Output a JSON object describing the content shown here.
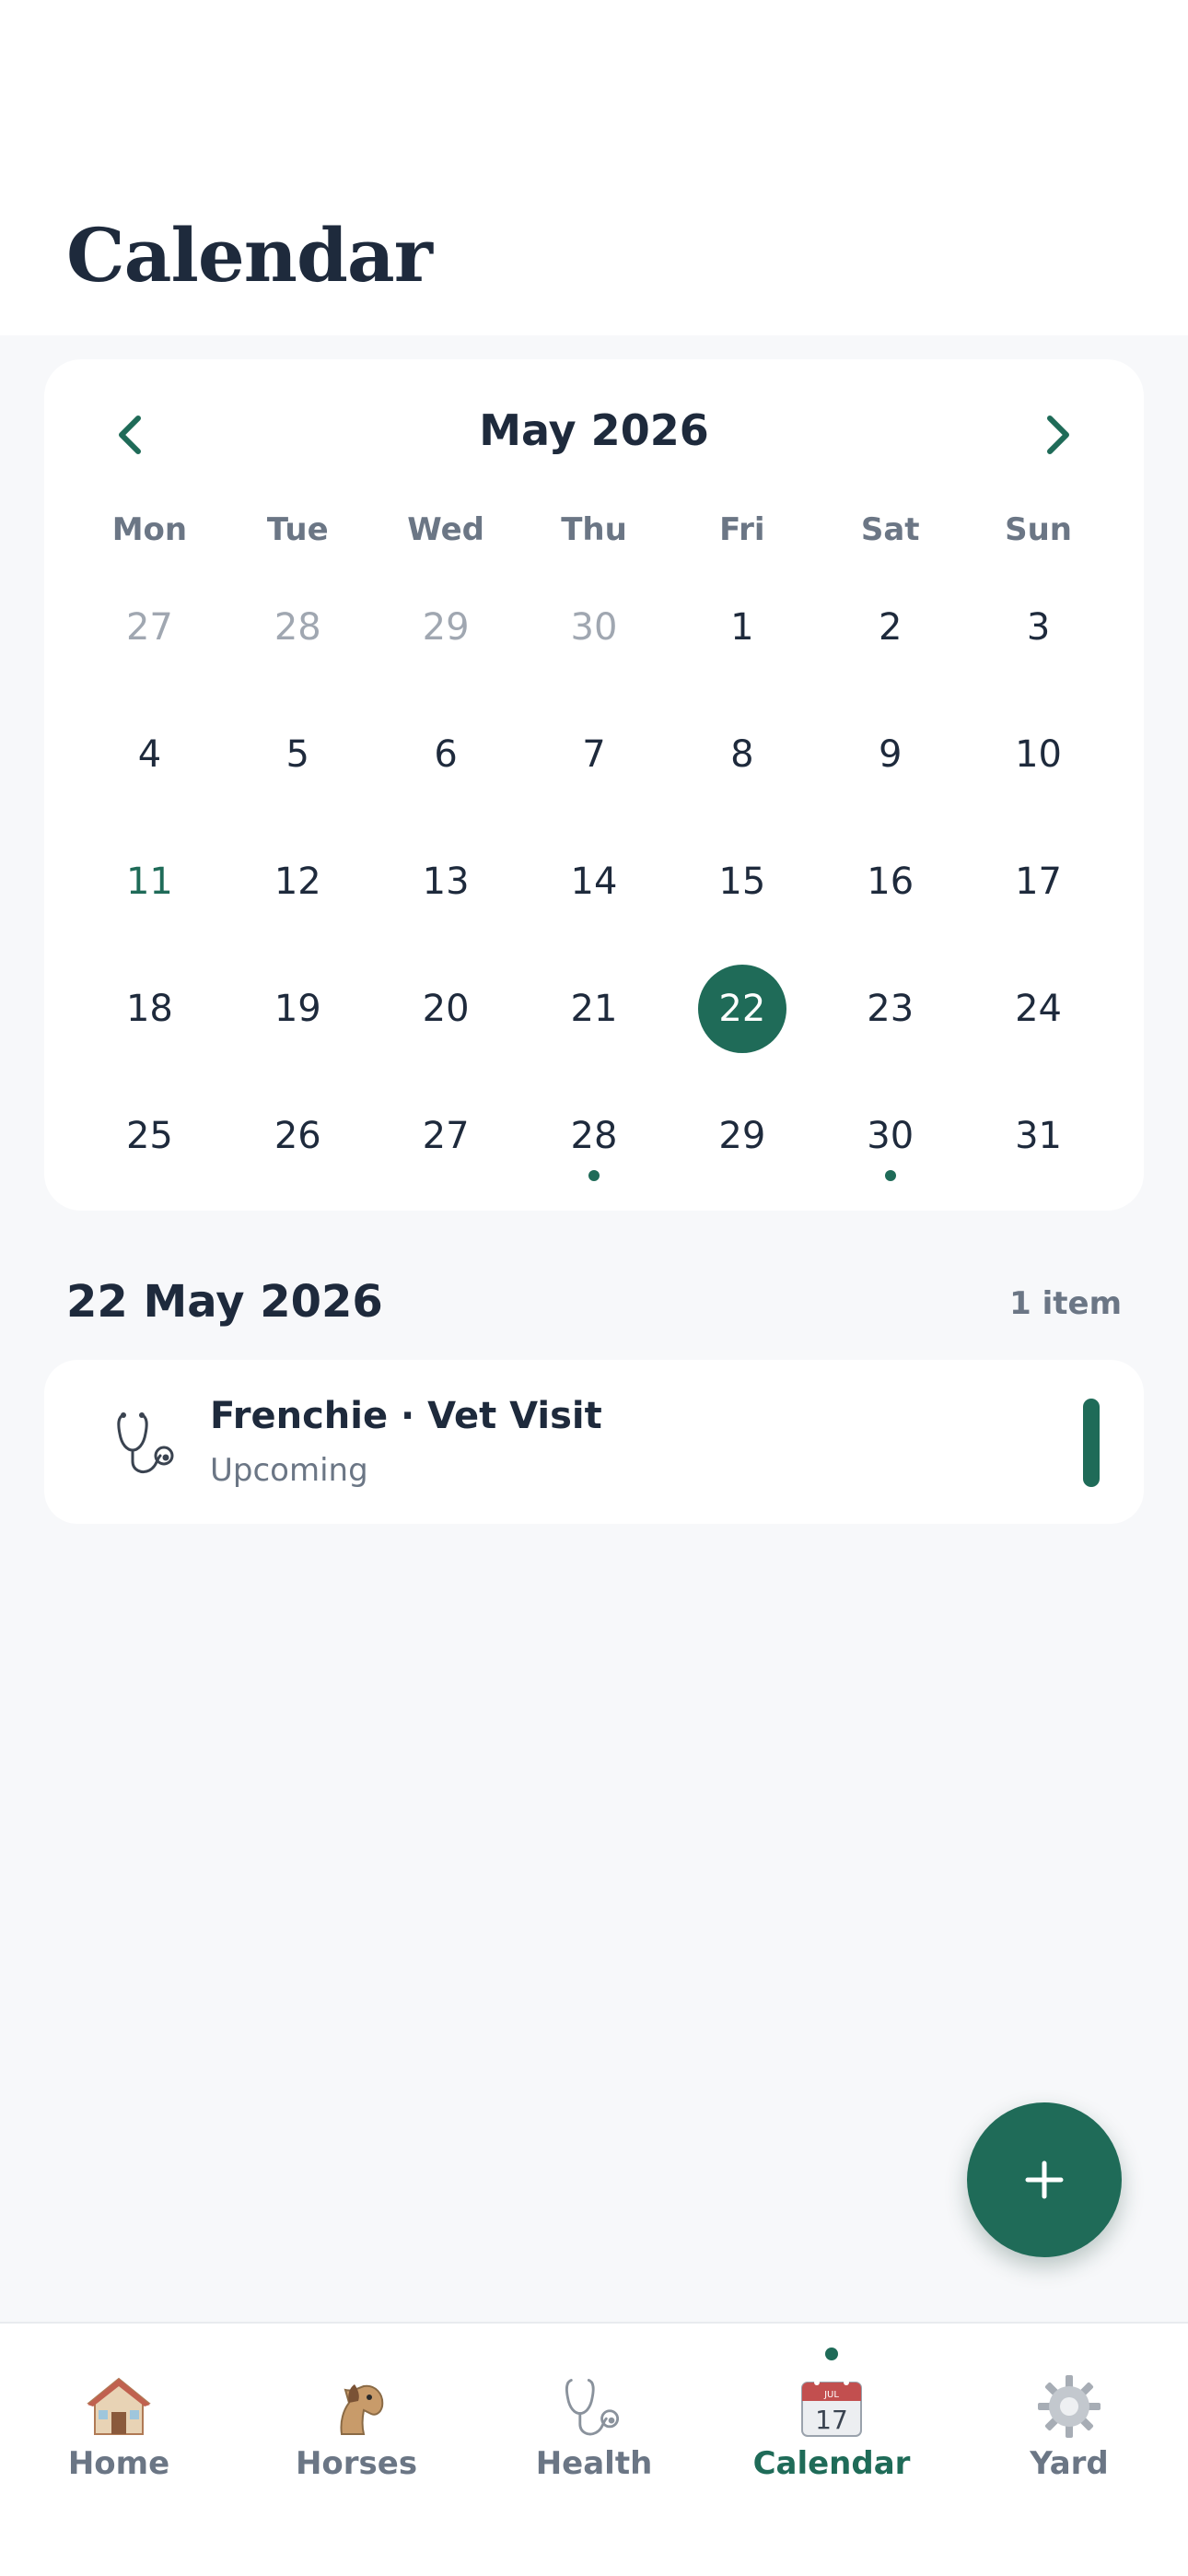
{
  "header": {
    "title": "Calendar"
  },
  "calendar": {
    "month_label": "May 2026",
    "prev_icon": "chevron-left-icon",
    "next_icon": "chevron-right-icon",
    "weekdays": [
      "Mon",
      "Tue",
      "Wed",
      "Thu",
      "Fri",
      "Sat",
      "Sun"
    ],
    "days": [
      {
        "n": "27",
        "muted": true
      },
      {
        "n": "28",
        "muted": true
      },
      {
        "n": "29",
        "muted": true
      },
      {
        "n": "30",
        "muted": true
      },
      {
        "n": "1"
      },
      {
        "n": "2"
      },
      {
        "n": "3"
      },
      {
        "n": "4"
      },
      {
        "n": "5"
      },
      {
        "n": "6"
      },
      {
        "n": "7"
      },
      {
        "n": "8"
      },
      {
        "n": "9"
      },
      {
        "n": "10"
      },
      {
        "n": "11",
        "today": true
      },
      {
        "n": "12"
      },
      {
        "n": "13"
      },
      {
        "n": "14"
      },
      {
        "n": "15"
      },
      {
        "n": "16"
      },
      {
        "n": "17"
      },
      {
        "n": "18"
      },
      {
        "n": "19"
      },
      {
        "n": "20"
      },
      {
        "n": "21"
      },
      {
        "n": "22",
        "selected": true
      },
      {
        "n": "23"
      },
      {
        "n": "24"
      },
      {
        "n": "25"
      },
      {
        "n": "26"
      },
      {
        "n": "27"
      },
      {
        "n": "28",
        "event": true
      },
      {
        "n": "29"
      },
      {
        "n": "30",
        "event": true
      },
      {
        "n": "31"
      }
    ]
  },
  "agenda": {
    "date": "22 May 2026",
    "count": "1 item",
    "events": [
      {
        "title": "Frenchie · Vet Visit",
        "status": "Upcoming",
        "icon": "stethoscope-icon"
      }
    ]
  },
  "fab": {
    "icon": "plus-icon"
  },
  "tabs": [
    {
      "label": "Home",
      "icon": "house-icon",
      "active": false
    },
    {
      "label": "Horses",
      "icon": "horse-icon",
      "active": false
    },
    {
      "label": "Health",
      "icon": "stethoscope-icon",
      "active": false
    },
    {
      "label": "Calendar",
      "icon": "calendar-icon",
      "active": true
    },
    {
      "label": "Yard",
      "icon": "gear-icon",
      "active": false
    }
  ],
  "colors": {
    "accent": "#1f6b58",
    "text": "#1e2a3c",
    "muted": "#6b7685",
    "background": "#f7f8fa"
  }
}
